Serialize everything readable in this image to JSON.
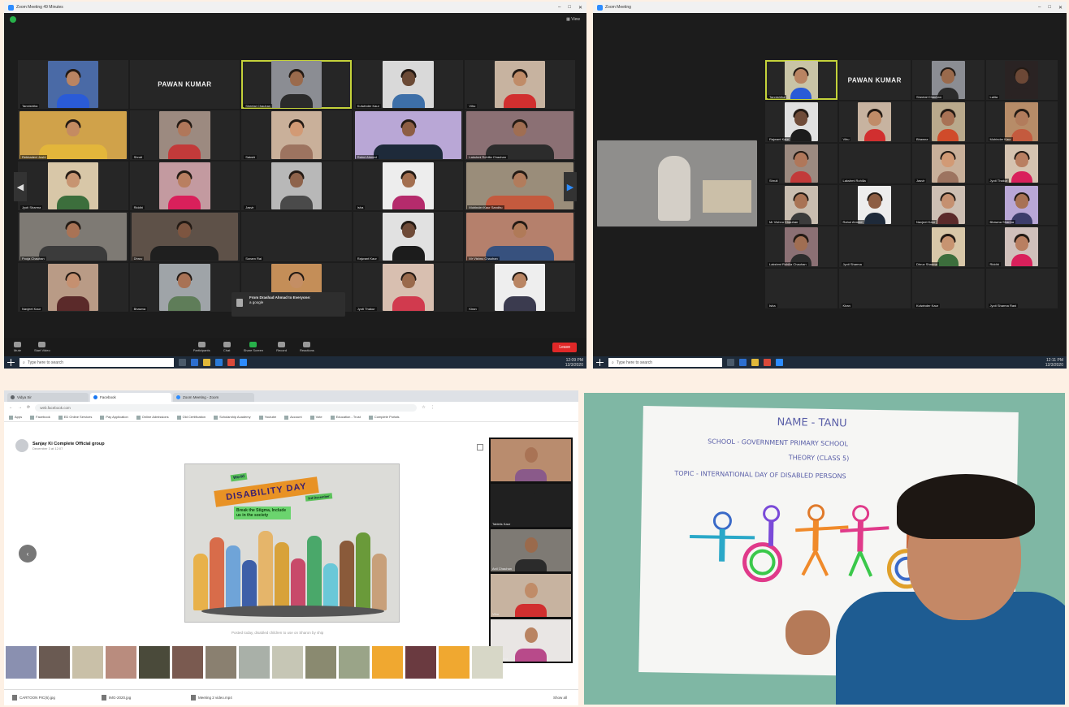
{
  "panel1": {
    "window_title": "Zoom Meeting 49 Minutes",
    "view_label": "View",
    "tiles": [
      {
        "name": "Tannishtha",
        "kind": "video",
        "bg": "#4a6aa6",
        "skin": "#b98462",
        "shirt": "#2a5bd7"
      },
      {
        "name": "",
        "kind": "name",
        "big": "PAWAN KUMAR"
      },
      {
        "name": "Sheetal Chauhan",
        "kind": "video",
        "bg": "#8b8d93",
        "skin": "#9a6a4c",
        "shirt": "#2b2b2b",
        "active": true
      },
      {
        "name": "Kulwinder Kaur",
        "kind": "video",
        "bg": "#d9d9d9",
        "skin": "#6b4a36",
        "shirt": "#3d6fa8"
      },
      {
        "name": "Vihu",
        "kind": "video",
        "bg": "#c7b3a0",
        "skin": "#c08c68",
        "shirt": "#d12f2f"
      },
      {
        "name": "Rekhadevi Joshi",
        "kind": "video",
        "bg": "#d0a24a",
        "skin": "#c48b62",
        "shirt": "#e3b63b",
        "wide": true
      },
      {
        "name": "Shruti",
        "kind": "video",
        "bg": "#9c8a80",
        "skin": "#b0775a",
        "shirt": "#c23a3a"
      },
      {
        "name": "Sakshi",
        "kind": "video",
        "bg": "#c9b09a",
        "skin": "#d29a75",
        "shirt": "#9d7460"
      },
      {
        "name": "Rahul Ahmed",
        "kind": "video",
        "bg": "#b9a7d6",
        "skin": "#8d5e44",
        "shirt": "#1e2a3a",
        "wide": true
      },
      {
        "name": "Lakshmi Rohilla Chauhan",
        "kind": "video",
        "bg": "#8b7074",
        "skin": "#a06e52",
        "shirt": "#2c2c2c",
        "wide": true
      },
      {
        "name": "Jyoti Sharma",
        "kind": "video",
        "bg": "#d8c7a8",
        "skin": "#c79471",
        "shirt": "#3c6e3c"
      },
      {
        "name": "Riddhi",
        "kind": "video",
        "bg": "#c39aa0",
        "skin": "#b97f61",
        "shirt": "#d9205b"
      },
      {
        "name": "Jasvir",
        "kind": "video",
        "bg": "#b8b8b8",
        "skin": "#8e634b",
        "shirt": "#4a4a4a"
      },
      {
        "name": "Isha",
        "kind": "video",
        "bg": "#ededed",
        "skin": "#a36f50",
        "shirt": "#b52b6c"
      },
      {
        "name": "Mohinder Kaur Sandhu",
        "kind": "video",
        "bg": "#9a8d7a",
        "skin": "#b27c5c",
        "shirt": "#c45a3e",
        "wide": true
      },
      {
        "name": "Pooja Chauhan",
        "kind": "video",
        "bg": "#7e7a74",
        "skin": "#a97355",
        "shirt": "#3b3b3b",
        "wide": true
      },
      {
        "name": "Dhruv",
        "kind": "video",
        "bg": "#5e5148",
        "skin": "#7d5540",
        "shirt": "#1f1f1f",
        "wide": true
      },
      {
        "name": "Sonam Rai",
        "kind": "empty"
      },
      {
        "name": "Rajwant Kaur",
        "kind": "video",
        "bg": "#e1e1e1",
        "skin": "#6f4b38",
        "shirt": "#1c1c1c"
      },
      {
        "name": "Mr Vishnu Chauhan",
        "kind": "video",
        "bg": "#b5806c",
        "skin": "#b07a58",
        "shirt": "#37517e",
        "wide": true
      },
      {
        "name": "Navjeet Kaur",
        "kind": "video",
        "bg": "#b99b86",
        "skin": "#c59070",
        "shirt": "#5b2a2a"
      },
      {
        "name": "Bhawna",
        "kind": "video",
        "bg": "#9fa4a8",
        "skin": "#a87255",
        "shirt": "#5f7d59"
      },
      {
        "name": "",
        "kind": "popup-video",
        "bg": "#c48e58",
        "skin": "#c48e64",
        "shirt": "#7a4f2e"
      },
      {
        "name": "Jyoti Thakur",
        "kind": "video",
        "bg": "#d8bfb0",
        "skin": "#9a6a4c",
        "shirt": "#d13a4e"
      },
      {
        "name": "Kiran",
        "kind": "video",
        "bg": "#eeeeee",
        "skin": "#b98563",
        "shirt": "#3b3b4f"
      }
    ],
    "chat_popup": {
      "from": "From Drashad Ahmad to Everyone:",
      "msg": "a google"
    },
    "toolbar": [
      {
        "label": "Mute",
        "green": false
      },
      {
        "label": "Start Video",
        "green": false
      },
      {
        "label": "Participants",
        "green": false
      },
      {
        "label": "Chat",
        "green": false
      },
      {
        "label": "Share Screen",
        "green": true
      },
      {
        "label": "Record",
        "green": false
      },
      {
        "label": "Reactions",
        "green": false
      }
    ],
    "end_label": "Leave",
    "taskbar": {
      "search": "Type here to search",
      "time": "12:09 PM",
      "date": "12/3/2020"
    }
  },
  "panel2": {
    "window_title": "Zoom Meeting",
    "taskbar": {
      "search": "Type here to search",
      "time": "12:11 PM",
      "date": "12/3/2020"
    },
    "feature_tile": {
      "bg": "#8f8e8c"
    },
    "tiles": [
      {
        "name": "Tannishtha",
        "kind": "video",
        "bg": "#c9c4a6",
        "skin": "#b98462",
        "shirt": "#2a5bd7",
        "active": true
      },
      {
        "name": "",
        "kind": "name",
        "big": "PAWAN KUMAR"
      },
      {
        "name": "Sheetal Chauhan",
        "kind": "video",
        "bg": "#8b8d93",
        "skin": "#9a6a4c",
        "shirt": "#2b2b2b"
      },
      {
        "name": "Lalita",
        "kind": "video",
        "bg": "#2a2323",
        "skin": "#6c4836",
        "shirt": "#2a2323"
      },
      {
        "name": "Rajwant Kaur",
        "kind": "video",
        "bg": "#e0e0e0",
        "skin": "#6f4b38",
        "shirt": "#1c1c1c"
      },
      {
        "name": "Vihu",
        "kind": "video",
        "bg": "#c7b3a0",
        "skin": "#c08c68",
        "shirt": "#d12f2f"
      },
      {
        "name": "Bhawna",
        "kind": "video",
        "bg": "#b9a98c",
        "skin": "#a87255",
        "shirt": "#d04b2a"
      },
      {
        "name": "Mohinder Kaur",
        "kind": "video",
        "bg": "#b78c68",
        "skin": "#b27c5c",
        "shirt": "#c45a3e"
      },
      {
        "name": "Shruti",
        "kind": "video",
        "bg": "#9c8a80",
        "skin": "#b0775a",
        "shirt": "#c23a3a"
      },
      {
        "name": "Lakshmi Rohilla",
        "kind": "empty"
      },
      {
        "name": "Jasvir",
        "kind": "video",
        "bg": "#c9b09a",
        "skin": "#d29a75",
        "shirt": "#9d7460"
      },
      {
        "name": "Jyoti Thakur",
        "kind": "video",
        "bg": "#d5c3b0",
        "skin": "#b97f61",
        "shirt": "#d9205b"
      },
      {
        "name": "Mr Vishnu Chauhan",
        "kind": "video",
        "bg": "#c9bdb0",
        "skin": "#a97355",
        "shirt": "#3b3b3b"
      },
      {
        "name": "Rahul Ahmed",
        "kind": "video",
        "bg": "#ededed",
        "skin": "#8d5e44",
        "shirt": "#1e2a3a"
      },
      {
        "name": "Navjeet Kaur",
        "kind": "video",
        "bg": "#cdbfb3",
        "skin": "#c59070",
        "shirt": "#5b2a2a"
      },
      {
        "name": "Bhawna Sharma",
        "kind": "video",
        "bg": "#b9a7d6",
        "skin": "#a87255",
        "shirt": "#3d3d6b"
      },
      {
        "name": "Lakshmi Rohilla Chauhan",
        "kind": "video",
        "bg": "#8b7074",
        "skin": "#a06e52",
        "shirt": "#2c2c2c"
      },
      {
        "name": "Jyoti Sharma",
        "kind": "empty"
      },
      {
        "name": "Dhruv Sharma",
        "kind": "video",
        "bg": "#d8c7a8",
        "skin": "#c79471",
        "shirt": "#3c6e3c"
      },
      {
        "name": "Riddhi",
        "kind": "video",
        "bg": "#d0c0bb",
        "skin": "#b97f61",
        "shirt": "#d9205b"
      },
      {
        "name": "Isha",
        "kind": "empty"
      },
      {
        "name": "Kiran",
        "kind": "empty"
      },
      {
        "name": "Kulwinder Kaur",
        "kind": "empty"
      },
      {
        "name": "Jyoti Sharma Rani",
        "kind": "empty"
      }
    ]
  },
  "panel3": {
    "tabs": [
      "Vidya Sir",
      "Facebook",
      "Zoom Meeting - Zoom"
    ],
    "url": "web.facebook.com",
    "bookmarks": [
      "Apps",
      "Facebook",
      "ED Online Services",
      "Pay Application",
      "Online Admissions",
      "Old Certification",
      "Scholarship Academy",
      "Youtube",
      "Account",
      "Vote",
      "Education - Trust",
      "Complete Portals"
    ],
    "post": {
      "group": "Sanjay Ki Complete Official group",
      "date": "December 3 at 12:07",
      "caption": "Posted today, disabled children to use on Sharon by ship"
    },
    "poster": {
      "pre": "World",
      "title": "DISABILITY DAY",
      "tag": "3rd December",
      "slogan": "Break the Stigma, Include us in the society"
    },
    "camera_feed": [
      {
        "name": "",
        "bg": "#b98c6e",
        "skin": "#a97355",
        "shirt": "#8a5a8a"
      },
      {
        "name": "Tablets Kaur",
        "bg": "#202020",
        "skin": "#202020",
        "shirt": "#202020"
      },
      {
        "name": "Anil Chauhan",
        "bg": "#7e7a74",
        "skin": "#9a6a4c",
        "shirt": "#2b2b2b"
      },
      {
        "name": "Vihu",
        "bg": "#c7b3a0",
        "skin": "#c08c68",
        "shirt": "#d12f2f"
      },
      {
        "name": "Tannishtha",
        "bg": "#e9e6e4",
        "skin": "#b98462",
        "shirt": "#b84a8a"
      }
    ],
    "thumb_colors": [
      "#8a90b0",
      "#6a5a52",
      "#c9c0a8",
      "#b98c7e",
      "#4a4a3a",
      "#7a5a50",
      "#8a8070",
      "#a9b0a8",
      "#c6c6b5",
      "#8a8a70",
      "#9aa488",
      "#f0a830",
      "#6a3a40",
      "#f0a830",
      "#d7d7c7"
    ],
    "downloads": [
      "CARTOON PIC(6).jpg",
      "IMG-2020.jpg",
      "Meeting 2 video.mp4"
    ],
    "show_all": "Show all"
  },
  "panel4": {
    "paper_lines": [
      {
        "text": "NAME - TANU",
        "size": 13
      },
      {
        "text": "SCHOOL - GOVERNMENT PRIMARY SCHOOL",
        "size": 8
      },
      {
        "text": "THEORY (CLASS 5)",
        "size": 8
      },
      {
        "text": "TOPIC - INTERNATIONAL DAY OF DISABLED PERSONS",
        "size": 8
      }
    ]
  }
}
